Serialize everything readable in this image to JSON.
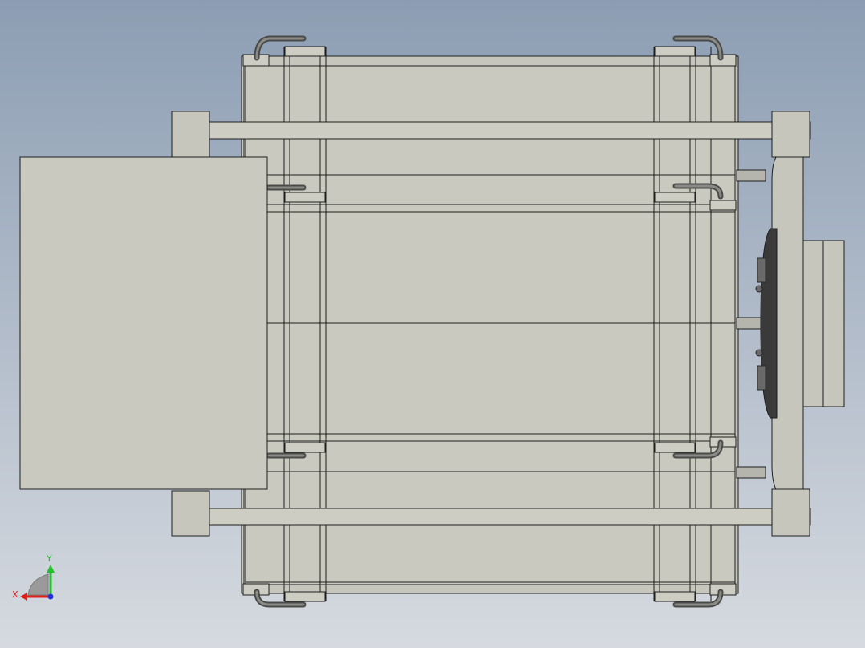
{
  "viewport": {
    "background_top": "#8c9db3",
    "background_bottom": "#d6dae0"
  },
  "model": {
    "body_fill": "#c6c6bd",
    "body_fill_light": "#cdcdc4",
    "edge_color": "#1e1e1e",
    "hose_color": "#8a8a86",
    "hose_dark": "#4a4a48",
    "dark_part": "#3a3a3a"
  },
  "triad": {
    "x_label": "X",
    "y_label": "Y",
    "x_color": "#e0201a",
    "y_color": "#22c02a",
    "z_color": "#2530e0",
    "arc_color": "#9a9a9a"
  }
}
